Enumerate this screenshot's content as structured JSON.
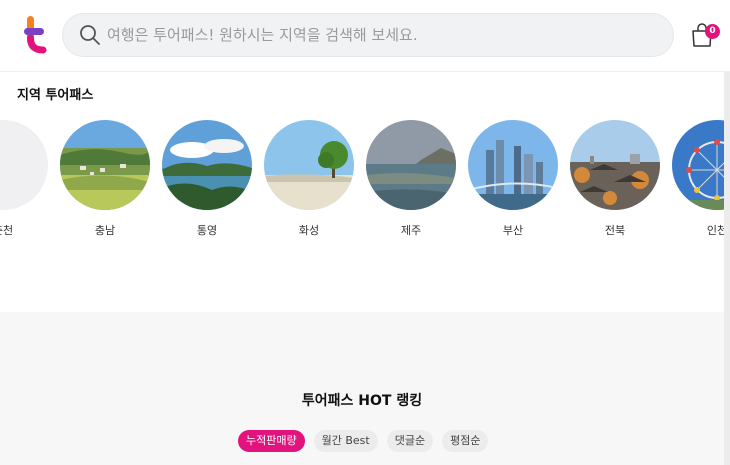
{
  "header": {
    "logo_icon": "tourpass-logo-icon",
    "search": {
      "placeholder": "여행은 투어패스! 원하시는 지역을 검색해 보세요.",
      "icon": "search-icon"
    },
    "cart": {
      "icon": "shopping-bag-icon",
      "count": "0"
    }
  },
  "region": {
    "title": "지역 투어패스",
    "items": [
      {
        "label": "춘천"
      },
      {
        "label": "충남"
      },
      {
        "label": "통영"
      },
      {
        "label": "화성"
      },
      {
        "label": "제주"
      },
      {
        "label": "부산"
      },
      {
        "label": "전북"
      },
      {
        "label": "인천"
      }
    ]
  },
  "ranking": {
    "title": "투어패스 HOT 랭킹",
    "tabs": [
      {
        "label": "누적판매량",
        "active": true
      },
      {
        "label": "월간 Best",
        "active": false
      },
      {
        "label": "댓글순",
        "active": false
      },
      {
        "label": "평점순",
        "active": false
      }
    ]
  },
  "colors": {
    "accent": "#e3137d",
    "logo_purple": "#7b3fc4",
    "logo_orange": "#f5821f"
  }
}
